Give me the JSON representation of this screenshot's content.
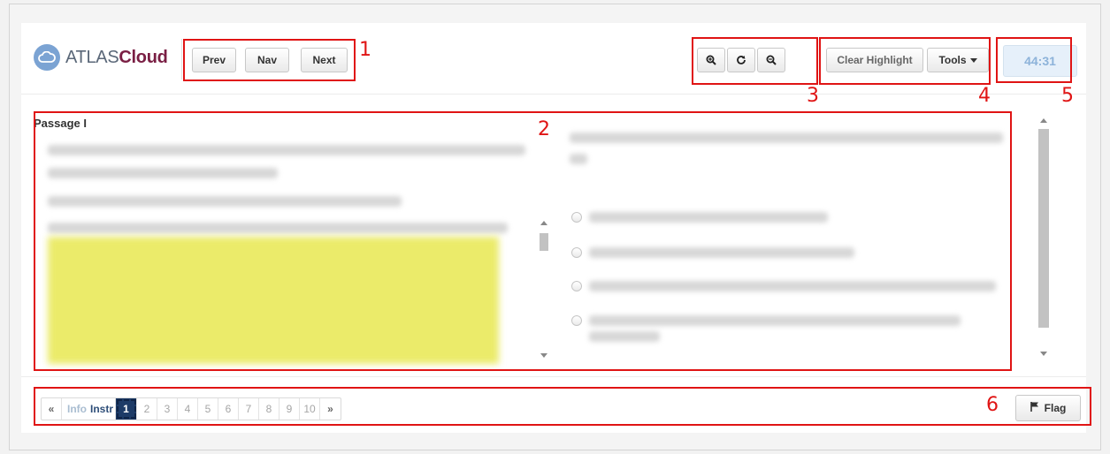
{
  "brand": {
    "name_light": "ATLAS",
    "name_bold": "Cloud"
  },
  "toolbar": {
    "prev_label": "Prev",
    "nav_label": "Nav",
    "next_label": "Next",
    "zoom_in_icon": "zoom-in-icon",
    "reset_icon": "refresh-icon",
    "zoom_out_icon": "zoom-out-icon",
    "clear_highlight_label": "Clear Highlight",
    "tools_label": "Tools"
  },
  "timer": {
    "value": "44:31"
  },
  "passage": {
    "title": "Passage I"
  },
  "annotations": [
    "1",
    "2",
    "3",
    "4",
    "5",
    "6"
  ],
  "pager": {
    "prev_symbol": "«",
    "info_label": "Info",
    "instr_label": "Instr",
    "current_page": "1",
    "pages": [
      "2",
      "3",
      "4",
      "5",
      "6",
      "7",
      "8",
      "9",
      "10"
    ],
    "next_symbol": "»"
  },
  "flag": {
    "label": "Flag"
  },
  "colors": {
    "annotation_red": "#e01414",
    "brand_blue": "#7ba3d3",
    "brand_maroon": "#7a1f44",
    "highlight_yellow": "#ebeb6a",
    "current_page_navy": "#1d3b67",
    "timer_text": "#8db3da"
  }
}
